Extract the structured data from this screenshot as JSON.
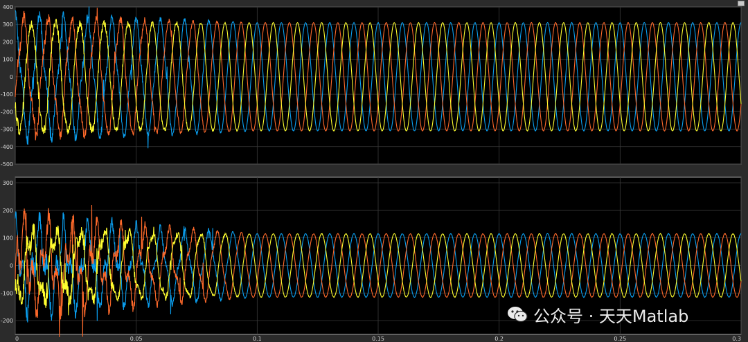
{
  "watermark": {
    "text": "公众号 · 天天Matlab",
    "icon": "wechat-icon"
  },
  "colors": {
    "background": "#000000",
    "frame": "#2b2b2b",
    "grid": "#3a3a3a",
    "axis": "#c8c8c8",
    "tick_text": "#d7d7d7"
  },
  "chart_data": [
    {
      "type": "line",
      "xlim": [
        0,
        0.3
      ],
      "ylim": [
        -500,
        400
      ],
      "xticks": [
        0,
        0.05,
        0.1,
        0.15,
        0.2,
        0.25,
        0.3
      ],
      "yticks": [
        400,
        300,
        200,
        100,
        0,
        -100,
        -200,
        -300,
        -400,
        -500
      ],
      "xtick_labels": [],
      "grid": true,
      "frequency_hz": 100,
      "series": [
        {
          "color": "#0a9ff0",
          "amplitude": 310,
          "phase_deg": 90,
          "transient_until": 0.1,
          "transient_peak": 410
        },
        {
          "color": "#ff6a2b",
          "amplitude": 310,
          "phase_deg": -30,
          "transient_until": 0.1,
          "transient_peak": 395
        },
        {
          "color": "#ffff30",
          "amplitude": 310,
          "phase_deg": 210,
          "transient_until": 0.1,
          "transient_peak": 330
        }
      ]
    },
    {
      "type": "line",
      "xlim": [
        0,
        0.3
      ],
      "ylim": [
        -250,
        320
      ],
      "xticks": [
        0,
        0.05,
        0.1,
        0.15,
        0.2,
        0.25,
        0.3
      ],
      "yticks": [
        300,
        200,
        100,
        0,
        -100,
        -200
      ],
      "xtick_labels": [
        "0",
        "0.05",
        "0.1",
        "0.15",
        "0.2",
        "0.25",
        "0.3"
      ],
      "grid": true,
      "frequency_hz": 100,
      "series": [
        {
          "color": "#0a9ff0",
          "amplitude": 115,
          "phase_deg": 90,
          "transient_until": 0.1,
          "transient_peak": 230
        },
        {
          "color": "#ff6a2b",
          "amplitude": 115,
          "phase_deg": -30,
          "transient_until": 0.1,
          "transient_peak": 260
        },
        {
          "color": "#ffff30",
          "amplitude": 115,
          "phase_deg": 210,
          "transient_until": 0.1,
          "transient_peak": 190
        }
      ]
    }
  ]
}
